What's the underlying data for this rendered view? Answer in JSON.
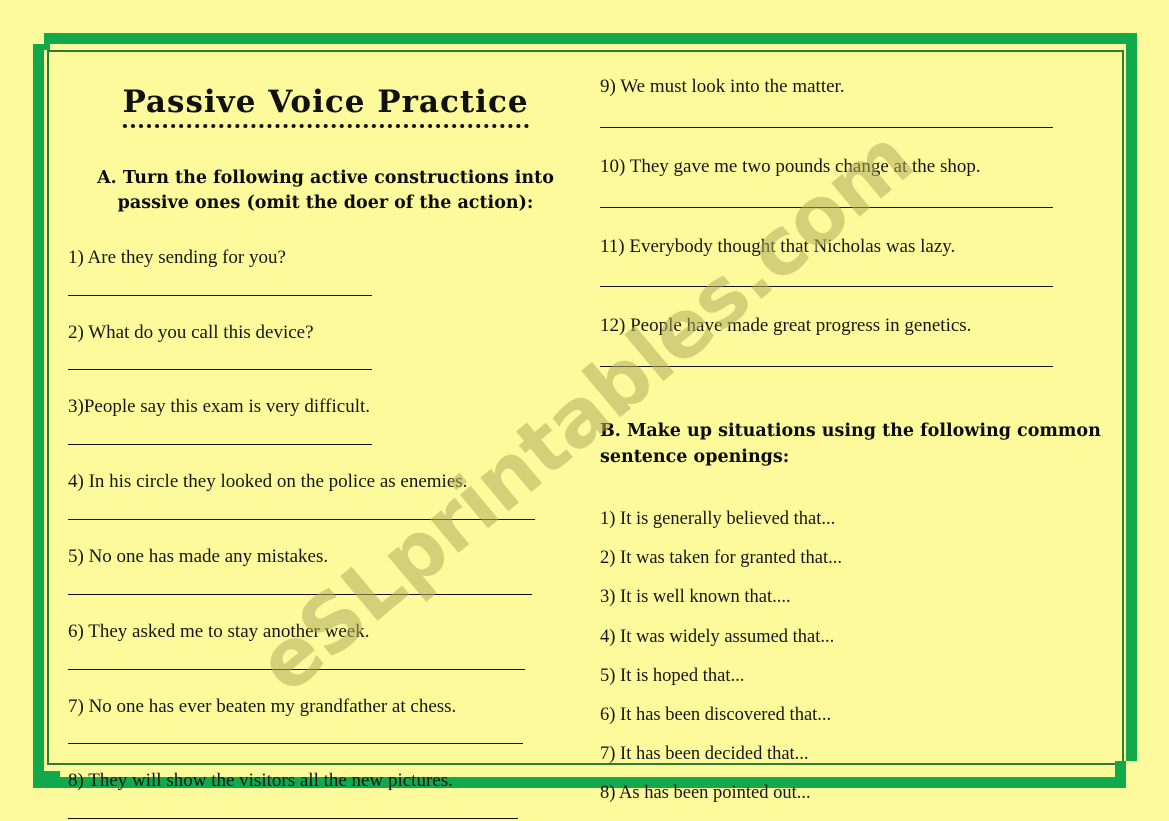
{
  "page": {
    "background_color": "#fcfa9b",
    "frame_color": "#12a84c",
    "frame_line_color": "#2f7a34",
    "text_color": "#161616"
  },
  "watermark": {
    "text": "eSLprintables.com",
    "color": "#b3ae5e"
  },
  "title": "Passive Voice Practice",
  "section_a": {
    "heading": "A. Turn the following active constructions into passive ones (omit the doer of the action):",
    "items": [
      {
        "text": "1) Are they sending for you?",
        "rule_width": 304
      },
      {
        "text": "2) What do you call this device?",
        "rule_width": 304
      },
      {
        "text": "3)People say this exam is very difficult.",
        "rule_width": 304
      },
      {
        "text": "4) In his circle they looked on the police as enemies.",
        "rule_width": 467
      },
      {
        "text": "5) No one has made any mistakes.",
        "rule_width": 464
      },
      {
        "text": "6) They asked me to stay another week.",
        "rule_width": 457
      },
      {
        "text": "7) No one has ever beaten my grandfather at chess.",
        "rule_width": 455
      },
      {
        "text": "8) They will show the visitors all the new pictures.",
        "rule_width": 450
      }
    ]
  },
  "section_a_continued": {
    "items": [
      {
        "text": "9) We must look into the matter.",
        "rule_width": 453
      },
      {
        "text": "10) They gave me two pounds change at the shop.",
        "rule_width": 453
      },
      {
        "text": "11) Everybody thought that Nicholas was lazy.",
        "rule_width": 453
      },
      {
        "text": "12) People have made great progress in genetics.",
        "rule_width": 453
      }
    ]
  },
  "section_b": {
    "heading": "B. Make up situations using the following common sentence openings:",
    "items": [
      "1) It is generally believed that...",
      "2) It was taken for granted that...",
      "3) It is well known that....",
      "4) It was widely assumed that...",
      "5) It is hoped that...",
      "6) It has been discovered that...",
      "7) It has been decided that...",
      "8) As has been pointed out..."
    ]
  }
}
